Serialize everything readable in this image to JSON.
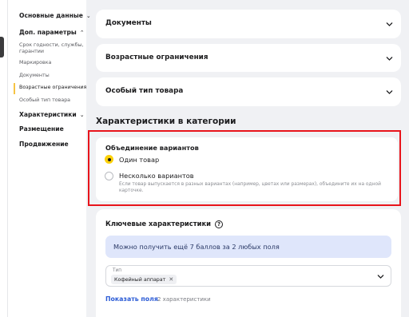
{
  "sidebar": {
    "sections": [
      {
        "label": "Основные данные",
        "chevron": "chevron-down-icon"
      },
      {
        "label": "Доп. параметры",
        "chevron": "chevron-up-icon"
      },
      {
        "label": "Характеристики",
        "chevron": "chevron-down-icon"
      },
      {
        "label": "Размещение"
      },
      {
        "label": "Продвижение"
      }
    ],
    "sub_items": [
      "Срок годности, службы, гарантии",
      "Маркировка",
      "Документы",
      "Возрастные ограничения",
      "Особый тип товара"
    ],
    "accent_color": "#f6c343"
  },
  "accordions": [
    "Документы",
    "Возрастные ограничения",
    "Особый тип товара"
  ],
  "section_title": "Характеристики в категории",
  "merge": {
    "title": "Объединение вариантов",
    "options": [
      "Один товар",
      "Несколько вариантов"
    ],
    "selected": 0,
    "hint": "Если товар выпускается в разных вариантах (например, цветах или размерах), объедините их на одной карточке.",
    "highlight_color": "#e8141b",
    "radio_color": "#fcd10a"
  },
  "key": {
    "title": "Ключевые характеристики",
    "help_icon": "?",
    "info": "Можно получить ещё 7 баллов за 2 любых поля",
    "type_label": "Тип",
    "type_value": "Кофейный аппарат",
    "chip_remove": "✕",
    "show_fields": "Показать поля",
    "fields_count": "2 характеристики",
    "link_color": "#2c5cd6"
  }
}
